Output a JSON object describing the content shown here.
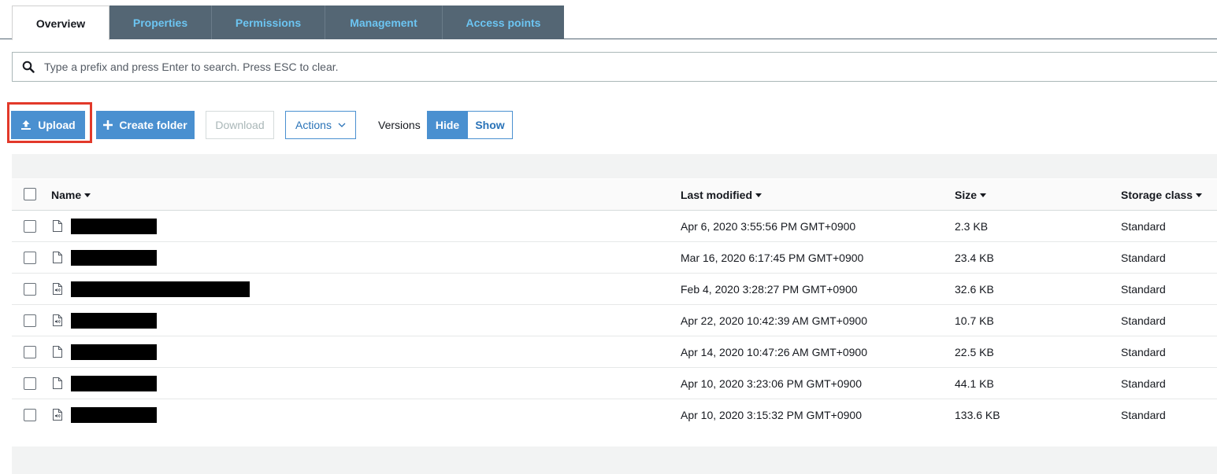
{
  "tabs": [
    {
      "label": "Overview",
      "active": true
    },
    {
      "label": "Properties",
      "active": false
    },
    {
      "label": "Permissions",
      "active": false
    },
    {
      "label": "Management",
      "active": false
    },
    {
      "label": "Access points",
      "active": false
    }
  ],
  "search": {
    "icon": "search-icon",
    "placeholder": "Type a prefix and press Enter to search. Press ESC to clear."
  },
  "toolbar": {
    "upload_label": "Upload",
    "create_folder_label": "Create folder",
    "download_label": "Download",
    "actions_label": "Actions",
    "versions_label": "Versions",
    "hide_label": "Hide",
    "show_label": "Show"
  },
  "table": {
    "columns": {
      "name": "Name",
      "last_modified": "Last modified",
      "size": "Size",
      "storage_class": "Storage class"
    },
    "rows": [
      {
        "icon": "file-icon",
        "name": "",
        "modified": "Apr 6, 2020 3:55:56 PM GMT+0900",
        "size": "2.3 KB",
        "storage": "Standard"
      },
      {
        "icon": "file-icon",
        "name": "",
        "modified": "Mar 16, 2020 6:17:45 PM GMT+0900",
        "size": "23.4 KB",
        "storage": "Standard"
      },
      {
        "icon": "audio-file-icon",
        "name": "",
        "modified": "Feb 4, 2020 3:28:27 PM GMT+0900",
        "size": "32.6 KB",
        "storage": "Standard"
      },
      {
        "icon": "audio-file-icon",
        "name": "",
        "modified": "Apr 22, 2020 10:42:39 AM GMT+0900",
        "size": "10.7 KB",
        "storage": "Standard"
      },
      {
        "icon": "file-icon",
        "name": "",
        "modified": "Apr 14, 2020 10:47:26 AM GMT+0900",
        "size": "22.5 KB",
        "storage": "Standard"
      },
      {
        "icon": "file-icon",
        "name": "",
        "modified": "Apr 10, 2020 3:23:06 PM GMT+0900",
        "size": "44.1 KB",
        "storage": "Standard"
      },
      {
        "icon": "audio-file-icon",
        "name": "",
        "modified": "Apr 10, 2020 3:15:32 PM GMT+0900",
        "size": "133.6 KB",
        "storage": "Standard"
      }
    ]
  },
  "colors": {
    "primary": "#4a90d0",
    "tab_bg": "#546674",
    "tab_text": "#6cc5f2",
    "highlight": "#e2392a"
  }
}
